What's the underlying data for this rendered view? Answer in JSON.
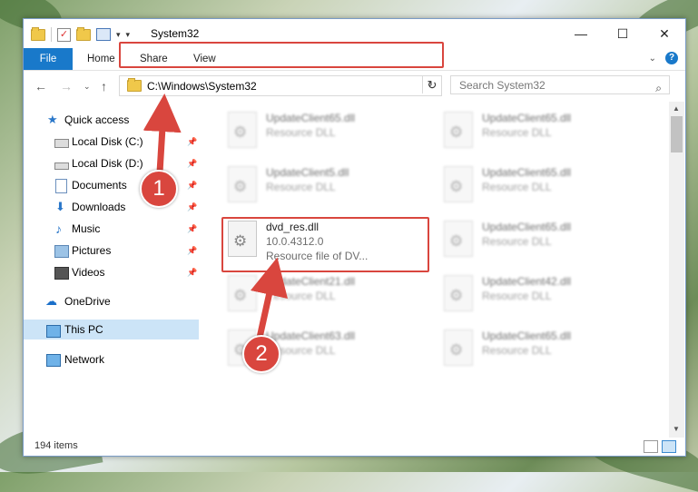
{
  "window": {
    "title": "System32",
    "minimize": "—",
    "maximize": "☐",
    "close": "✕"
  },
  "ribbon": {
    "file": "File",
    "home": "Home",
    "share": "Share",
    "view": "View"
  },
  "address": {
    "path": "C:\\Windows\\System32",
    "search_placeholder": "Search System32"
  },
  "sidebar": {
    "items": [
      {
        "label": "Quick access"
      },
      {
        "label": "Local Disk (C:)"
      },
      {
        "label": "Local Disk (D:)"
      },
      {
        "label": "Documents"
      },
      {
        "label": "Downloads"
      },
      {
        "label": "Music"
      },
      {
        "label": "Pictures"
      },
      {
        "label": "Videos"
      },
      {
        "label": "OneDrive"
      },
      {
        "label": "This PC"
      },
      {
        "label": "Network"
      }
    ]
  },
  "files": {
    "col1": [
      {
        "name": "UpdateClient65.dll",
        "desc": "Resource DLL"
      },
      {
        "name": "UpdateClient5.dll",
        "desc": "Resource DLL"
      },
      {
        "name": "dvd_res.dll",
        "version": "10.0.4312.0",
        "desc": "Resource file of DV..."
      },
      {
        "name": "UpdateClient21.dll",
        "desc": "Resource DLL"
      },
      {
        "name": "UpdateClient63.dll",
        "desc": "Resource DLL"
      }
    ],
    "col2": [
      {
        "name": "UpdateClient65.dll",
        "desc": "Resource DLL"
      },
      {
        "name": "UpdateClient65.dll",
        "desc": "Resource DLL"
      },
      {
        "name": "UpdateClient65.dll",
        "desc": "Resource DLL"
      },
      {
        "name": "UpdateClient42.dll",
        "desc": "Resource DLL"
      },
      {
        "name": "UpdateClient65.dll",
        "desc": "Resource DLL"
      }
    ]
  },
  "status": {
    "count": "194 items"
  },
  "callouts": {
    "one": "1",
    "two": "2"
  }
}
